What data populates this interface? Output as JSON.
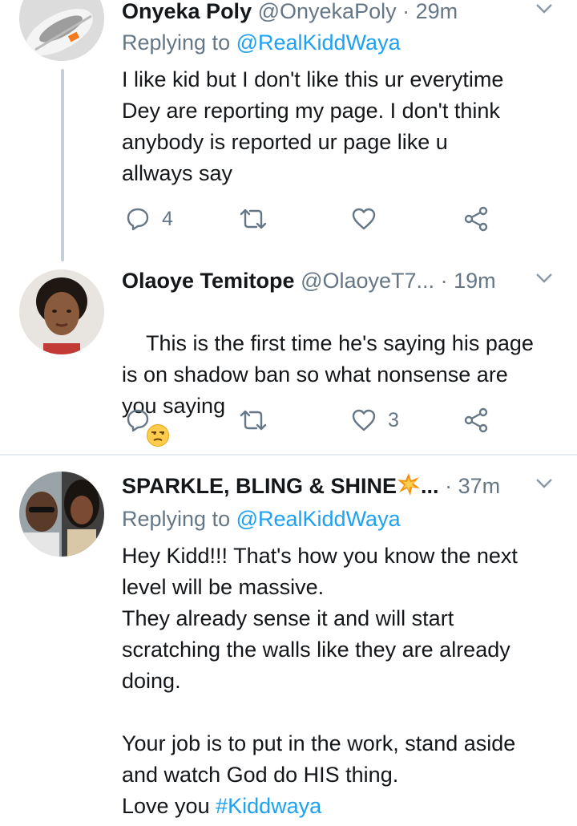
{
  "tweets": [
    {
      "name": "Onyeka Poly",
      "handle": "@OnyekaPoly",
      "time": "29m",
      "replying_label": "Replying to ",
      "replying_handle": "@RealKiddWaya",
      "text": "I like kid but I don't like this ur everytime\nDey are reporting my page. I don't think\nanybody is reported ur page like u\nallways say",
      "reply_count": "4",
      "retweet_count": "",
      "like_count": ""
    },
    {
      "name": "Olaoye Temitope",
      "handle": "@OlaoyeT7...",
      "time": "19m",
      "text": "This is the first time he's saying his page\nis on shadow ban so what nonsense are\nyou saying",
      "emoji": "unamused-face",
      "reply_count": "",
      "retweet_count": "",
      "like_count": "3"
    },
    {
      "name": "SPARKLE, BLING & SHINE",
      "name_suffix": "...",
      "emoji": "collision",
      "handle": "",
      "time": "37m",
      "replying_label": "Replying to ",
      "replying_handle": "@RealKiddWaya",
      "text": "Hey Kidd!!! That's how you know the next\nlevel will be massive.\nThey already sense it and will start\nscratching the walls like they are already\ndoing.\n\nYour job is to put in the work, stand aside\nand watch God do HIS thing.\nLove you ",
      "hashtag": "#Kiddwaya"
    }
  ],
  "icons": [
    "reply-icon",
    "retweet-icon",
    "like-icon",
    "share-icon",
    "chevron-down-icon"
  ],
  "colors": {
    "link": "#1da1f2",
    "secondary_text": "#657786",
    "thread_line": "#c4cfd6"
  }
}
